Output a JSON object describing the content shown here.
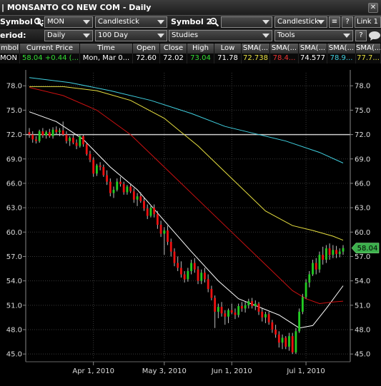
{
  "window": {
    "title": "| MONSANTO CO NEW COM - Daily"
  },
  "toolbar1": {
    "symbol1_label": "Symbol 1:",
    "symbol1_value": "MON",
    "chart_style": "Candlestick",
    "symbol2_label": "Symbol 2:",
    "symbol2_value": "",
    "chart_style2": "Candlestick",
    "link_label": "Link 1"
  },
  "toolbar2": {
    "period_label": "eriod:",
    "period_value": "Daily",
    "range_value": "100 Day",
    "studies_label": "Studies",
    "tools_label": "Tools"
  },
  "quote_table": {
    "headers": [
      "mbol",
      "Current Price",
      "Time",
      "Open",
      "Close",
      "High",
      "Low",
      "SMA(...",
      "SMA(...",
      "SMA(...",
      "SMA(...",
      "SMA(..."
    ],
    "row": [
      "MON",
      "58.04",
      "+0.44 (...",
      "Mon, Mar 0...",
      "72.60",
      "72.02",
      "73.04",
      "71.78",
      "72.738",
      "78.4...",
      "74.577",
      "78.9...",
      "77.7..."
    ]
  },
  "colors": {
    "up_candle": "#22cc22",
    "down_candle": "#ee1111",
    "sma_white": "#ffffff",
    "sma_yellow": "#e8e040",
    "sma_red": "#cc1111",
    "sma_cyan": "#40d0e0",
    "ref_line": "#cccccc",
    "price_badge": "#3cb04c"
  },
  "chart_data": {
    "type": "candlestick",
    "ylim": [
      44.4,
      79.6
    ],
    "yticks": [
      "45.0",
      "48.0",
      "51.0",
      "54.0",
      "57.0",
      "60.0",
      "63.0",
      "66.0",
      "69.0",
      "72.0",
      "75.0",
      "78.0"
    ],
    "xticks": [
      {
        "label": "Apr 1, 2010",
        "idx": 19
      },
      {
        "label": "May 3, 2010",
        "idx": 40
      },
      {
        "label": "Jun 1, 2010",
        "idx": 60
      },
      {
        "label": "Jul 1, 2010",
        "idx": 82
      }
    ],
    "reference_line": 72.0,
    "last_price_label": "58.04",
    "last_price": 58.04,
    "candles": [
      [
        72.3,
        72.8,
        71.6,
        72.0
      ],
      [
        72.0,
        72.4,
        71.0,
        71.4
      ],
      [
        71.4,
        71.8,
        70.9,
        71.2
      ],
      [
        71.2,
        72.6,
        71.0,
        72.4
      ],
      [
        72.4,
        72.8,
        71.6,
        71.9
      ],
      [
        71.9,
        72.5,
        71.5,
        72.3
      ],
      [
        72.3,
        72.7,
        71.6,
        71.8
      ],
      [
        71.8,
        72.9,
        71.5,
        72.6
      ],
      [
        72.6,
        73.0,
        72.0,
        72.3
      ],
      [
        72.3,
        72.8,
        71.8,
        72.5
      ],
      [
        72.5,
        73.6,
        71.8,
        72.0
      ],
      [
        72.0,
        72.4,
        70.9,
        71.2
      ],
      [
        71.2,
        71.8,
        70.6,
        71.6
      ],
      [
        71.6,
        72.0,
        70.8,
        71.0
      ],
      [
        71.0,
        71.4,
        70.2,
        70.6
      ],
      [
        70.6,
        72.0,
        70.4,
        71.8
      ],
      [
        71.8,
        72.0,
        70.5,
        70.8
      ],
      [
        70.8,
        71.0,
        69.4,
        69.6
      ],
      [
        69.6,
        70.0,
        68.6,
        68.9
      ],
      [
        68.9,
        69.2,
        66.8,
        67.2
      ],
      [
        67.2,
        68.4,
        66.9,
        68.2
      ],
      [
        68.2,
        68.6,
        67.6,
        68.0
      ],
      [
        68.0,
        68.3,
        66.8,
        67.0
      ],
      [
        67.0,
        67.6,
        65.8,
        66.2
      ],
      [
        66.2,
        66.6,
        64.4,
        64.8
      ],
      [
        64.8,
        65.6,
        64.2,
        65.2
      ],
      [
        65.2,
        66.6,
        65.0,
        66.2
      ],
      [
        66.2,
        66.8,
        65.6,
        65.9
      ],
      [
        65.9,
        66.2,
        64.6,
        64.9
      ],
      [
        64.9,
        65.8,
        64.6,
        65.6
      ],
      [
        65.6,
        66.0,
        64.8,
        65.0
      ],
      [
        65.0,
        65.4,
        63.6,
        64.0
      ],
      [
        64.0,
        64.8,
        63.2,
        64.4
      ],
      [
        64.4,
        64.9,
        63.6,
        63.8
      ],
      [
        63.8,
        64.2,
        62.6,
        62.9
      ],
      [
        62.9,
        63.4,
        61.6,
        62.0
      ],
      [
        62.0,
        63.2,
        61.8,
        63.0
      ],
      [
        63.0,
        63.4,
        61.8,
        62.2
      ],
      [
        62.2,
        62.6,
        60.4,
        60.9
      ],
      [
        60.9,
        61.4,
        59.4,
        59.8
      ],
      [
        59.8,
        60.6,
        57.2,
        60.2
      ],
      [
        60.2,
        60.8,
        58.4,
        58.8
      ],
      [
        58.8,
        59.2,
        57.0,
        57.6
      ],
      [
        57.6,
        58.0,
        55.8,
        56.2
      ],
      [
        56.2,
        57.0,
        55.2,
        55.6
      ],
      [
        55.6,
        56.4,
        54.4,
        54.8
      ],
      [
        54.8,
        55.2,
        53.8,
        54.2
      ],
      [
        54.2,
        55.6,
        53.9,
        55.2
      ],
      [
        55.2,
        56.6,
        54.8,
        56.2
      ],
      [
        56.2,
        56.8,
        55.0,
        55.4
      ],
      [
        55.4,
        55.8,
        53.6,
        54.0
      ],
      [
        54.0,
        55.4,
        53.6,
        55.0
      ],
      [
        55.0,
        55.6,
        53.8,
        54.2
      ],
      [
        54.2,
        54.8,
        52.6,
        53.0
      ],
      [
        53.0,
        53.4,
        51.6,
        51.9
      ],
      [
        51.9,
        52.2,
        48.2,
        50.2
      ],
      [
        50.2,
        51.2,
        49.4,
        50.8
      ],
      [
        50.8,
        51.4,
        49.6,
        50.0
      ],
      [
        50.0,
        50.4,
        48.6,
        49.6
      ],
      [
        49.6,
        50.6,
        48.8,
        50.4
      ],
      [
        50.4,
        51.2,
        49.9,
        50.1
      ],
      [
        50.1,
        50.6,
        49.3,
        49.8
      ],
      [
        49.8,
        51.2,
        49.5,
        50.9
      ],
      [
        50.9,
        51.4,
        50.2,
        50.6
      ],
      [
        50.6,
        51.4,
        50.1,
        51.0
      ],
      [
        51.0,
        51.8,
        50.6,
        51.5
      ],
      [
        51.5,
        51.9,
        50.6,
        50.9
      ],
      [
        50.9,
        51.6,
        50.4,
        51.2
      ],
      [
        51.2,
        51.4,
        49.8,
        50.2
      ],
      [
        50.2,
        50.6,
        49.0,
        49.5
      ],
      [
        49.5,
        50.2,
        48.8,
        49.9
      ],
      [
        49.9,
        50.2,
        48.6,
        48.9
      ],
      [
        48.9,
        49.2,
        47.6,
        48.0
      ],
      [
        48.0,
        48.6,
        47.0,
        47.4
      ],
      [
        47.4,
        47.8,
        45.8,
        46.4
      ],
      [
        46.4,
        47.4,
        45.6,
        47.0
      ],
      [
        47.0,
        47.2,
        45.6,
        45.9
      ],
      [
        45.9,
        47.6,
        45.4,
        47.2
      ],
      [
        47.2,
        47.6,
        45.0,
        45.2
      ],
      [
        45.2,
        48.2,
        45.0,
        47.8
      ],
      [
        47.8,
        50.6,
        47.6,
        50.2
      ],
      [
        50.2,
        52.4,
        49.9,
        52.0
      ],
      [
        52.0,
        54.2,
        51.8,
        53.8
      ],
      [
        53.8,
        55.2,
        53.2,
        54.8
      ],
      [
        54.8,
        56.6,
        54.6,
        56.2
      ],
      [
        56.2,
        56.8,
        54.8,
        55.4
      ],
      [
        55.4,
        57.6,
        55.0,
        57.2
      ],
      [
        57.2,
        58.2,
        56.0,
        56.6
      ],
      [
        56.6,
        58.4,
        56.2,
        58.0
      ],
      [
        58.0,
        58.6,
        56.6,
        57.2
      ],
      [
        57.2,
        58.4,
        56.8,
        57.8
      ],
      [
        57.8,
        58.3,
        56.8,
        57.3
      ],
      [
        57.3,
        58.0,
        56.9,
        57.6
      ],
      [
        57.6,
        58.4,
        57.2,
        58.04
      ]
    ],
    "sma_lines": [
      {
        "color_key": "sma_white",
        "points": [
          [
            0,
            74.8
          ],
          [
            8,
            73.6
          ],
          [
            16,
            71.4
          ],
          [
            24,
            68.0
          ],
          [
            32,
            65.2
          ],
          [
            40,
            61.4
          ],
          [
            48,
            57.6
          ],
          [
            56,
            54.0
          ],
          [
            62,
            51.8
          ],
          [
            68,
            50.8
          ],
          [
            74,
            49.8
          ],
          [
            80,
            48.2
          ],
          [
            84,
            48.5
          ],
          [
            88,
            50.6
          ],
          [
            93,
            53.4
          ]
        ]
      },
      {
        "color_key": "sma_yellow",
        "points": [
          [
            0,
            77.9
          ],
          [
            10,
            77.9
          ],
          [
            20,
            77.4
          ],
          [
            30,
            76.2
          ],
          [
            40,
            74.0
          ],
          [
            50,
            70.6
          ],
          [
            60,
            66.6
          ],
          [
            70,
            62.6
          ],
          [
            78,
            60.8
          ],
          [
            84,
            60.2
          ],
          [
            90,
            59.5
          ],
          [
            93,
            59.0
          ]
        ]
      },
      {
        "color_key": "sma_red",
        "points": [
          [
            0,
            77.8
          ],
          [
            10,
            76.8
          ],
          [
            20,
            75.0
          ],
          [
            30,
            72.0
          ],
          [
            40,
            68.0
          ],
          [
            50,
            64.0
          ],
          [
            60,
            60.0
          ],
          [
            70,
            56.0
          ],
          [
            78,
            52.8
          ],
          [
            82,
            51.8
          ],
          [
            86,
            51.2
          ],
          [
            90,
            51.4
          ],
          [
            93,
            51.5
          ]
        ]
      },
      {
        "color_key": "sma_cyan",
        "points": [
          [
            0,
            79.0
          ],
          [
            12,
            78.4
          ],
          [
            24,
            77.4
          ],
          [
            36,
            76.2
          ],
          [
            48,
            74.6
          ],
          [
            58,
            73.0
          ],
          [
            66,
            72.2
          ],
          [
            76,
            71.2
          ],
          [
            86,
            69.8
          ],
          [
            93,
            68.5
          ]
        ]
      }
    ]
  }
}
